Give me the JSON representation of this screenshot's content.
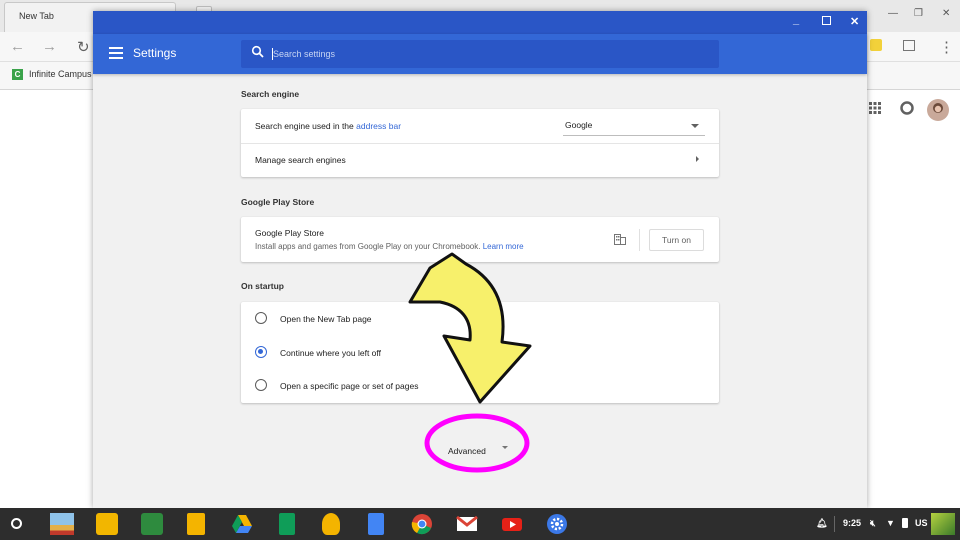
{
  "browser": {
    "tab_title": "New Tab",
    "bookmark": "Infinite Campus",
    "bookmark_icon_letter": "C"
  },
  "settings": {
    "title": "Settings",
    "search_placeholder": "Search settings",
    "sections": {
      "search_engine": {
        "heading": "Search engine",
        "used_label_prefix": "Search engine used in the ",
        "used_label_link": "address bar",
        "selected_engine": "Google",
        "manage_label": "Manage search engines"
      },
      "play_store": {
        "heading": "Google Play Store",
        "title": "Google Play Store",
        "description": "Install apps and games from Google Play on your Chromebook.",
        "learn_more": "Learn more",
        "button": "Turn on"
      },
      "startup": {
        "heading": "On startup",
        "options": [
          {
            "label": "Open the New Tab page",
            "checked": false
          },
          {
            "label": "Continue where you left off",
            "checked": true
          },
          {
            "label": "Open a specific page or set of pages",
            "checked": false
          }
        ]
      }
    },
    "advanced_label": "Advanced"
  },
  "annotations": {
    "arrow_color": "#f7f06b",
    "circle_color": "#ff00ff"
  },
  "shelf": {
    "time": "9:25",
    "ime": "US"
  },
  "colors": {
    "header_blue": "#3367d6",
    "titlebar_blue": "#2a56c6",
    "link_blue": "#3367d6"
  }
}
